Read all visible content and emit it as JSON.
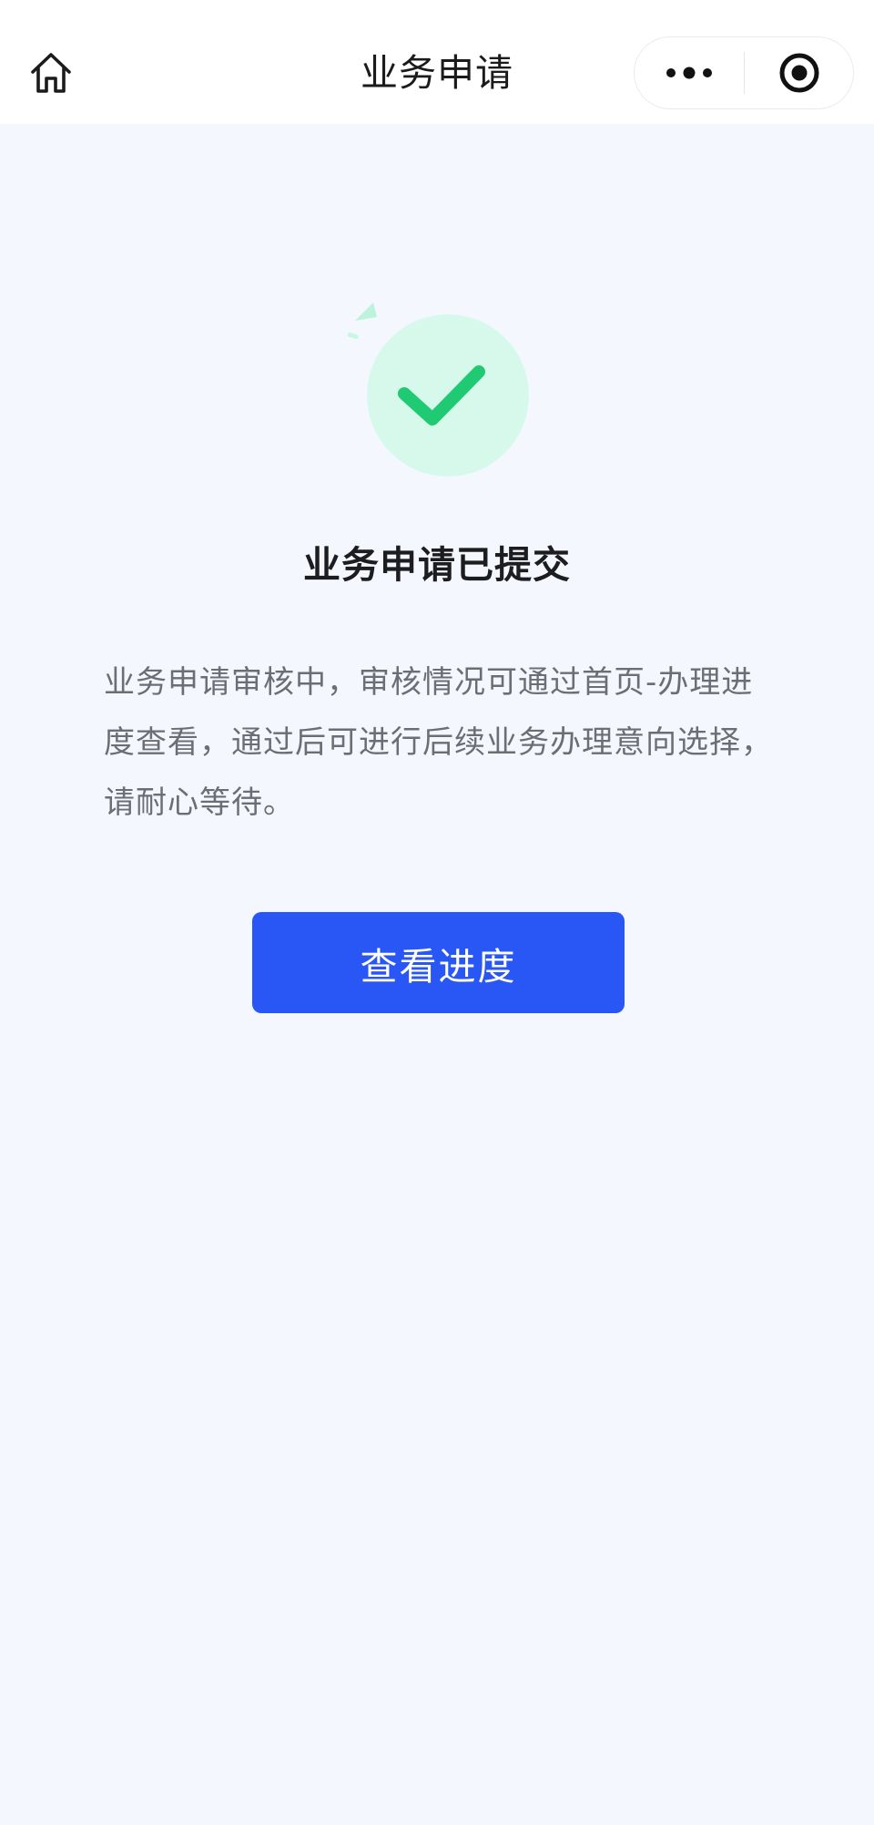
{
  "nav": {
    "title": "业务申请",
    "home_icon": "home-icon",
    "more_icon": "more-dots-icon",
    "close_icon": "record-circle-icon"
  },
  "result": {
    "status_icon": "check-circle-icon",
    "title": "业务申请已提交",
    "description": "业务申请审核中，审核情况可通过首页-办理进度查看，通过后可进行后续业务办理意向选择，请耐心等待。"
  },
  "actions": {
    "view_progress_label": "查看进度"
  },
  "colors": {
    "page_background": "#f4f8fe",
    "header_background": "#ffffff",
    "primary_button": "#2857f5",
    "success_green": "#1fca72",
    "success_circle": "#d7f9ec",
    "title_text": "#1d1d1f",
    "body_text": "#6b6e73"
  }
}
